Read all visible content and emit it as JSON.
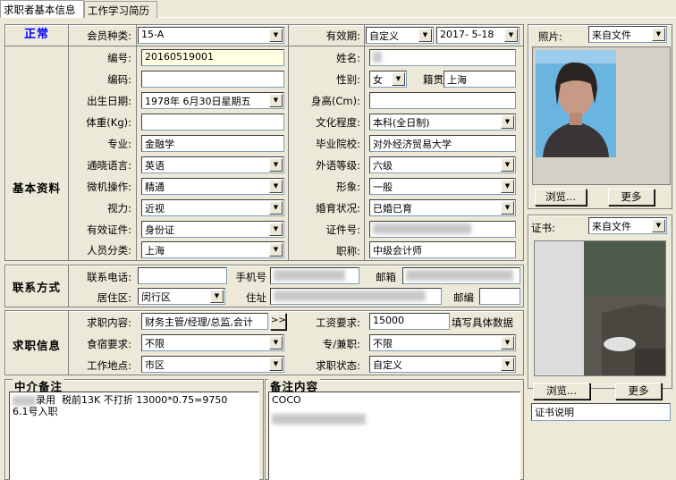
{
  "tabs": [
    "求职者基本信息",
    "工作学习简历"
  ],
  "status": "正常",
  "sections": {
    "basic": "基本资料",
    "contact": "联系方式",
    "job": "求职信息",
    "agent_note": "中介备注",
    "note": "备注内容"
  },
  "fields": {
    "member_type_label": "会员种类:",
    "member_type": "15-A",
    "validity_label": "有效期:",
    "validity_type": "自定义",
    "validity_date": "2017- 5-18",
    "id_no_label": "编号:",
    "id_no": "20160519001",
    "name_label": "姓名:",
    "code_label": "编码:",
    "gender_label": "性别:",
    "gender": "女",
    "origin_label": "籍贯",
    "origin": "上海",
    "birth_label": "出生日期:",
    "birth": "1978年 6月30日星期五",
    "height_label": "身高(Cm):",
    "weight_label": "体重(Kg):",
    "education_label": "文化程度:",
    "education": "本科(全日制)",
    "major_label": "专业:",
    "major": "金融学",
    "school_label": "毕业院校:",
    "school": "对外经济贸易大学",
    "language_label": "通晓语言:",
    "language": "英语",
    "lang_level_label": "外语等级:",
    "lang_level": "六级",
    "computer_label": "微机操作:",
    "computer": "精通",
    "appearance_label": "形象:",
    "appearance": "一般",
    "vision_label": "视力:",
    "vision": "近视",
    "marital_label": "婚育状况:",
    "marital": "已婚已育",
    "cert_type_label": "有效证件:",
    "cert_type": "身份证",
    "cert_no_label": "证件号:",
    "category_label": "人员分类:",
    "category": "上海",
    "title_label": "职称:",
    "title": "中级会计师",
    "phone_label": "联系电话:",
    "mobile_label": "手机号",
    "email_label": "邮箱",
    "district_label": "居住区:",
    "district": "闵行区",
    "address_label": "住址",
    "zip_label": "邮编",
    "job_content_label": "求职内容:",
    "job_content": "财务主管/经理/总监,会计",
    "salary_label": "工资要求:",
    "salary": "15000",
    "salary_hint": "填写具体数据",
    "board_label": "食宿要求:",
    "board": "不限",
    "fulltime_label": "专/兼职:",
    "fulltime": "不限",
    "location_label": "工作地点:",
    "location": "市区",
    "job_status_label": "求职状态:",
    "job_status": "自定义"
  },
  "agent_note_text": "录用  税前13K 不打折 13000*0.75=9750\n6.1号入职",
  "note_text": "COCO",
  "photo": {
    "label": "照片:",
    "source": "来自文件",
    "browse": "浏览...",
    "more": "更多"
  },
  "certificate": {
    "label": "证书:",
    "source": "来自文件",
    "browse": "浏览...",
    "more": "更多",
    "caption": "证书说明"
  }
}
